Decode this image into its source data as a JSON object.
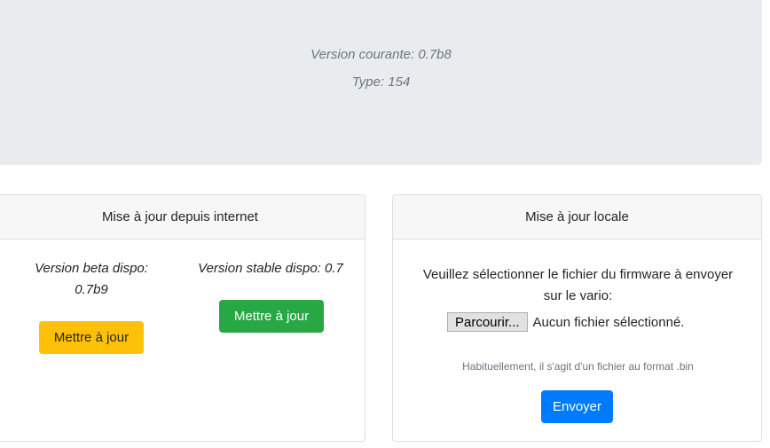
{
  "header": {
    "current_version_line": "Version courante: 0.7b8",
    "type_line": "Type: 154"
  },
  "internet_update": {
    "title": "Mise à jour depuis internet",
    "beta": {
      "label": "Version beta dispo:",
      "version": "0.7b9",
      "button_label": "Mettre à jour"
    },
    "stable": {
      "label_line": "Version stable dispo: 0.7",
      "button_label": "Mettre à jour"
    }
  },
  "local_update": {
    "title": "Mise à jour locale",
    "instruction_line1": "Veuillez sélectionner le fichier du firmware à envoyer",
    "instruction_line2": "sur le vario:",
    "browse_label": "Parcourir...",
    "file_status": "Aucun fichier sélectionné.",
    "help": "Habituellement, il s'agit d'un fichier au format .bin",
    "submit_label": "Envoyer"
  },
  "colors": {
    "jumbotron_bg": "#e9ecef",
    "warning": "#ffc107",
    "success": "#28a745",
    "primary": "#007bff"
  }
}
